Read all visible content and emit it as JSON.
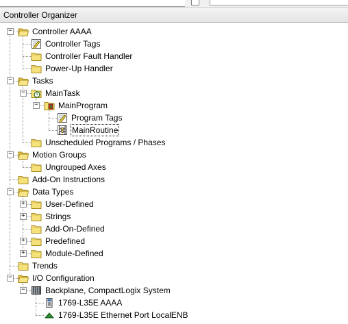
{
  "panel": {
    "title": "Controller Organizer"
  },
  "tree": [
    {
      "label": "Controller AAAA"
    },
    {
      "label": "Controller Tags"
    },
    {
      "label": "Controller Fault Handler"
    },
    {
      "label": "Power-Up Handler"
    },
    {
      "label": "Tasks"
    },
    {
      "label": "MainTask"
    },
    {
      "label": "MainProgram"
    },
    {
      "label": "Program Tags"
    },
    {
      "label": "MainRoutine"
    },
    {
      "label": "Unscheduled Programs / Phases"
    },
    {
      "label": "Motion Groups"
    },
    {
      "label": "Ungrouped Axes"
    },
    {
      "label": "Add-On Instructions"
    },
    {
      "label": "Data Types"
    },
    {
      "label": "User-Defined"
    },
    {
      "label": "Strings"
    },
    {
      "label": "Add-On-Defined"
    },
    {
      "label": "Predefined"
    },
    {
      "label": "Module-Defined"
    },
    {
      "label": "Trends"
    },
    {
      "label": "I/O Configuration"
    },
    {
      "label": "Backplane, CompactLogix System"
    },
    {
      "label": "1769-L35E AAAA"
    },
    {
      "label": "1769-L35E Ethernet Port LocalENB"
    }
  ],
  "icons": {
    "folder": "folder-icon",
    "open_folder": "open-folder-icon",
    "tags": "tags-icon",
    "task": "task-icon",
    "program": "program-icon",
    "routine": "ladder-routine-icon",
    "backplane": "backplane-icon",
    "module": "module-icon",
    "ethernet": "ethernet-port-icon"
  },
  "colors": {
    "folder": "#f5e27a",
    "selection_border": "#000000",
    "header_bg": "#ececec"
  }
}
